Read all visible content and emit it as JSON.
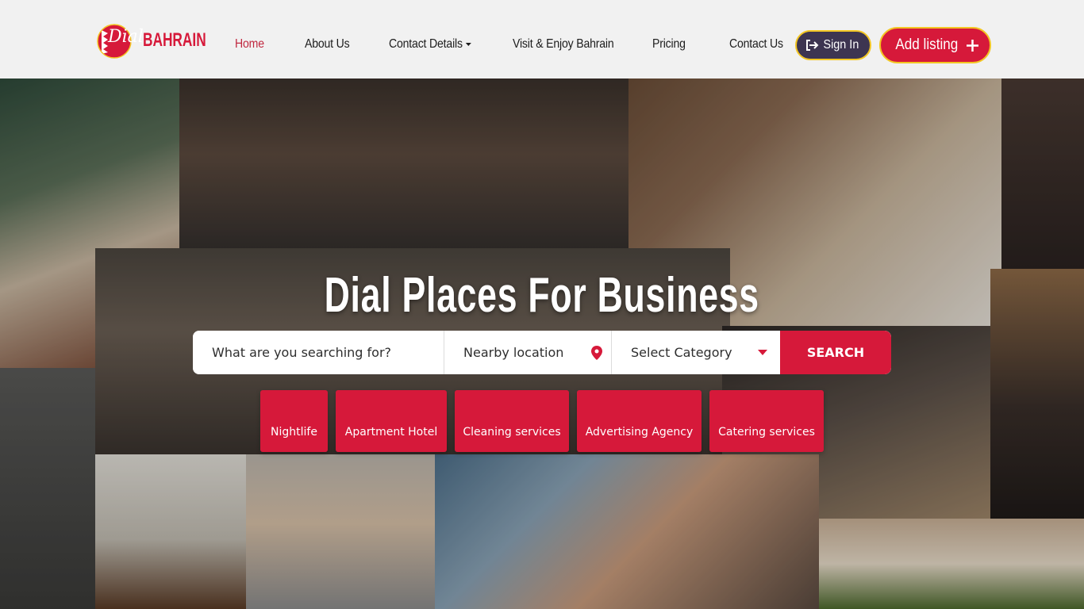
{
  "brand": {
    "logo_script": "Dial",
    "logo_text": "BAHRAIN"
  },
  "nav": {
    "items": [
      {
        "label": "Home",
        "active": true
      },
      {
        "label": "About Us"
      },
      {
        "label": "Contact Details"
      },
      {
        "label": "Visit & Enjoy Bahrain"
      },
      {
        "label": "Pricing"
      },
      {
        "label": "Contact Us"
      }
    ],
    "sign_in": "Sign In",
    "add_listing": "Add listing"
  },
  "hero": {
    "title": "Dial Places For Business"
  },
  "search": {
    "query_placeholder": "What are you searching for?",
    "location_placeholder": "Nearby location",
    "category_selected": "Select Category",
    "button": "SEARCH"
  },
  "categories": [
    "Nightlife",
    "Apartment Hotel",
    "Cleaning services",
    "Advertising Agency",
    "Catering services"
  ],
  "colors": {
    "accent": "#d6193a",
    "active_nav": "#c0283f",
    "signin_bg": "#3d3551",
    "button_border": "#f3c623",
    "header_bg": "#f1f1f1"
  }
}
